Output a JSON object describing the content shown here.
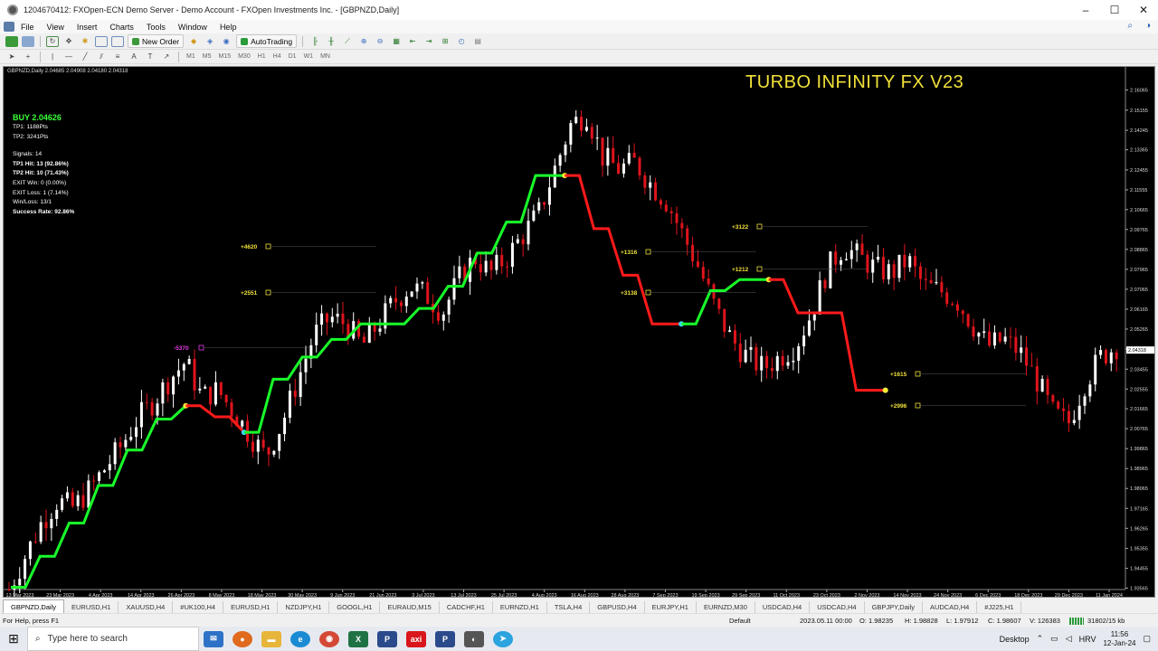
{
  "window": {
    "title": "1204670412: FXOpen-ECN Demo Server - Demo Account - FXOpen Investments Inc. - [GBPNZD,Daily]",
    "controls": [
      "–",
      "☐",
      "✕"
    ]
  },
  "menu": [
    "File",
    "View",
    "Insert",
    "Charts",
    "Tools",
    "Window",
    "Help"
  ],
  "toolbar": {
    "new_order_label": "New Order",
    "autotrading_label": "AutoTrading",
    "timeframes": [
      "M1",
      "M5",
      "M15",
      "M30",
      "H1",
      "H4",
      "D1",
      "W1",
      "MN"
    ]
  },
  "chart": {
    "symbol_line": "GBPNZD,Daily  2.04685 2.04908 2.04180 2.04318",
    "brand_title": "TURBO INFINITY FX V23",
    "panel": {
      "buy": "BUY 2.04626",
      "tp1": "TP1: 1188Pts",
      "tp2": "TP2: 3241Pts",
      "signals": "Signals: 14",
      "tp1_hit": "TP1 Hit: 13 (92.86%)",
      "tp2_hit": "TP2 Hit: 10 (71.43%)",
      "exit_win": "EXIT Win: 0 (0.00%)",
      "exit_loss": "EXIT Loss: 1 (7.14%)",
      "win_loss": "Win/Loss: 13/1",
      "success_rate": "Success Rate: 92.86%"
    },
    "current_price_label": "2.04318",
    "colors": {
      "bull": "#ffffff",
      "bear": "#e0141c",
      "trend_up": "#18ff2a",
      "trend_down": "#ff1a1a",
      "labels": "#f2e13a",
      "loss": "#e63ce6",
      "brand": "#f2e13a"
    }
  },
  "chart_data": {
    "type": "candlestick",
    "symbol": "GBPNZD",
    "timeframe": "Daily",
    "ohlc_current": {
      "open": 2.04685,
      "high": 2.04908,
      "low": 2.0418,
      "close": 2.04318
    },
    "y_ticks": [
      2.16065,
      2.15155,
      2.14245,
      2.13365,
      2.12455,
      2.11555,
      2.10665,
      2.09765,
      2.08865,
      2.07965,
      2.07065,
      2.06165,
      2.05265,
      2.04365,
      2.03455,
      2.02555,
      2.01665,
      2.00765,
      1.99865,
      1.98965,
      1.98065,
      1.97165,
      1.96265,
      1.95355,
      1.94455,
      1.93565
    ],
    "x_ticks": [
      "13 Mar 2023",
      "23 Mar 2023",
      "4 Apr 2023",
      "14 Apr 2023",
      "26 Apr 2023",
      "8 May 2023",
      "18 May 2023",
      "30 May 2023",
      "9 Jun 2023",
      "21 Jun 2023",
      "3 Jul 2023",
      "13 Jul 2023",
      "25 Jul 2023",
      "4 Aug 2023",
      "16 Aug 2023",
      "28 Aug 2023",
      "7 Sep 2023",
      "19 Sep 2023",
      "29 Sep 2023",
      "11 Oct 2023",
      "23 Oct 2023",
      "2 Nov 2023",
      "14 Nov 2023",
      "24 Nov 2023",
      "6 Dec 2023",
      "18 Dec 2023",
      "29 Dec 2023",
      "11 Jan 2024"
    ],
    "ylim": [
      1.935,
      2.167
    ],
    "close_path": [
      1.935,
      1.95,
      1.965,
      1.975,
      1.972,
      1.98,
      1.99,
      2.0,
      2.012,
      2.02,
      2.03,
      2.038,
      2.022,
      2.025,
      2.015,
      2.005,
      1.995,
      2.01,
      2.03,
      2.05,
      2.058,
      2.055,
      2.045,
      2.055,
      2.065,
      2.072,
      2.068,
      2.06,
      2.075,
      2.085,
      2.078,
      2.085,
      2.095,
      2.105,
      2.125,
      2.145,
      2.15,
      2.13,
      2.125,
      2.128,
      2.118,
      2.11,
      2.095,
      2.08,
      2.062,
      2.048,
      2.04,
      2.035,
      2.04,
      2.045,
      2.06,
      2.08,
      2.09,
      2.085,
      2.08,
      2.078,
      2.084,
      2.072,
      2.07,
      2.066,
      2.055,
      2.045,
      2.048,
      2.042,
      2.03,
      2.015,
      2.01,
      2.028,
      2.04,
      2.045
    ],
    "trend_line": [
      {
        "dir": "up",
        "levels": [
          1.936,
          1.95,
          1.965,
          1.982,
          1.998,
          2.012,
          2.018
        ]
      },
      {
        "dir": "down",
        "levels": [
          2.018,
          2.013,
          2.006
        ]
      },
      {
        "dir": "up",
        "levels": [
          2.006,
          2.03,
          2.04,
          2.048,
          2.055,
          2.055,
          2.062,
          2.072,
          2.087,
          2.101,
          2.122,
          2.122
        ]
      },
      {
        "dir": "down",
        "levels": [
          2.122,
          2.098,
          2.077,
          2.055,
          2.055
        ]
      },
      {
        "dir": "up",
        "levels": [
          2.055,
          2.07,
          2.075,
          2.075
        ]
      },
      {
        "dir": "down",
        "levels": [
          2.075,
          2.06,
          2.06,
          2.025,
          2.025
        ]
      },
      {
        "dir": "up",
        "levels": [
          2.025
        ]
      }
    ],
    "signal_labels": [
      {
        "text": "+4620"
      },
      {
        "text": "+2551"
      },
      {
        "text": "-5370"
      },
      {
        "text": "+1316"
      },
      {
        "text": "+3138"
      },
      {
        "text": "+3122"
      },
      {
        "text": "+1212"
      },
      {
        "text": "+1615"
      },
      {
        "text": "+2996"
      }
    ]
  },
  "tabs": [
    "GBPNZD,Daily",
    "EURUSD,H1",
    "XAUUSD,H4",
    "#UK100,H4",
    "EURUSD,H1",
    "NZDJPY,H1",
    "GOOGL,H1",
    "EURAUD,M15",
    "CADCHF,H1",
    "EURNZD,H1",
    "TSLA,H4",
    "GBPUSD,H4",
    "EURJPY,H1",
    "EURNZD,M30",
    "USDCAD,H4",
    "USDCAD,H4",
    "GBPJPY,Daily",
    "AUDCAD,H4",
    "#J225,H1"
  ],
  "status": {
    "help": "For Help, press F1",
    "profile": "Default",
    "datetime": "2023.05.11 00:00",
    "open": "O: 1.98235",
    "high": "H: 1.98828",
    "low": "L: 1.97912",
    "close": "C: 1.98607",
    "volume": "V: 126383",
    "traffic": "31802/15 kb"
  },
  "taskbar": {
    "search_placeholder": "Type here to search",
    "desktop_label": "Desktop",
    "lang": "HRV",
    "time": "11:56",
    "date": "12-Jan-24"
  }
}
